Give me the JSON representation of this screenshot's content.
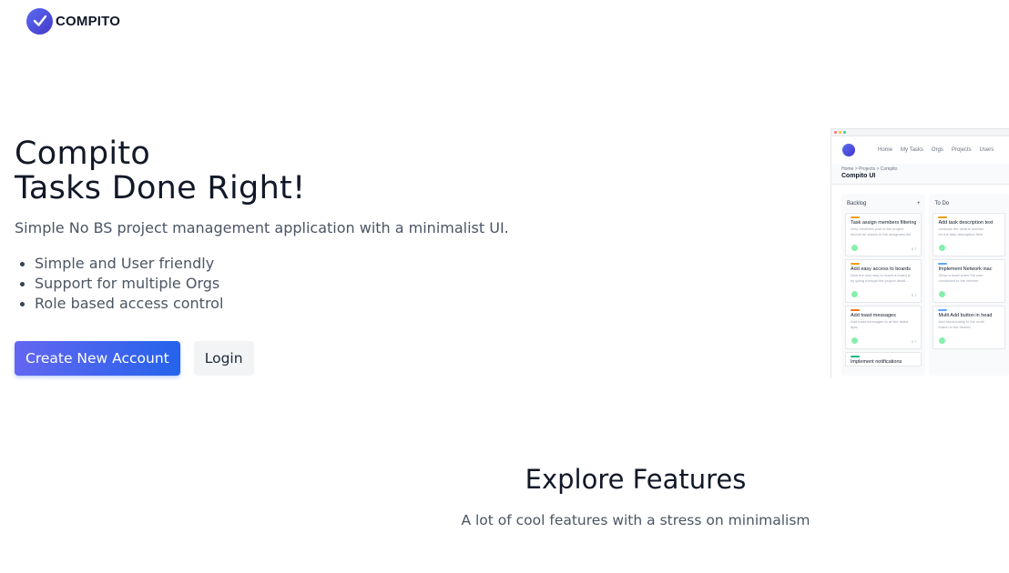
{
  "brand": {
    "name": "COMPITO",
    "accent": "#5b6cf0"
  },
  "hero": {
    "title_line1": "Compito",
    "title_line2": "Tasks Done Right!",
    "subtitle": "Simple No BS project management application with a minimalist UI.",
    "features": [
      "Simple and User friendly",
      "Support for multiple Orgs",
      "Role based access control"
    ],
    "primary_button": "Create New Account",
    "secondary_button": "Login"
  },
  "preview": {
    "nav": [
      "Home",
      "My Tasks",
      "Orgs",
      "Projects",
      "Users"
    ],
    "breadcrumb": "Home > Projects > Compito",
    "project": "Compito UI",
    "columns": [
      {
        "name": "Backlog",
        "add": "+",
        "cards": [
          {
            "tag_color": "#f59e0b",
            "title": "Task assign members filtering",
            "desc1": "Only members part of the project",
            "desc2": "should be shown in the assignees list",
            "meta": "0  7"
          },
          {
            "tag_color": "#f59e0b",
            "title": "Add easy access to boards",
            "desc1": "Now the only way to reach a board is",
            "desc2": "by going through the project detail...",
            "meta": "0  7"
          },
          {
            "tag_color": "#f97316",
            "title": "Add toast messages",
            "desc1": "Add toast messages to all the failed",
            "desc2": "apis.",
            "meta": "0  7"
          },
          {
            "tag_color": "#10b981",
            "title": "Implement notifications",
            "desc1": "",
            "desc2": "",
            "meta": ""
          }
        ]
      },
      {
        "name": "To Do",
        "add": "",
        "cards": [
          {
            "tag_color": "#f59e0b",
            "title": "Add task description text",
            "desc1": "Increase the default number",
            "desc2": "for the task description field",
            "meta": ""
          },
          {
            "tag_color": "#60a5fa",
            "title": "Implement Network inac",
            "desc1": "Show a toast when the user",
            "desc2": "connected to the internet",
            "meta": ""
          },
          {
            "tag_color": "#60a5fa",
            "title": "Multi Add button in head",
            "desc1": "Add functionality to the multi",
            "desc2": "button in the header",
            "meta": ""
          }
        ]
      }
    ]
  },
  "explore": {
    "title": "Explore Features",
    "subtitle": "A lot of cool features with a stress on minimalism"
  }
}
